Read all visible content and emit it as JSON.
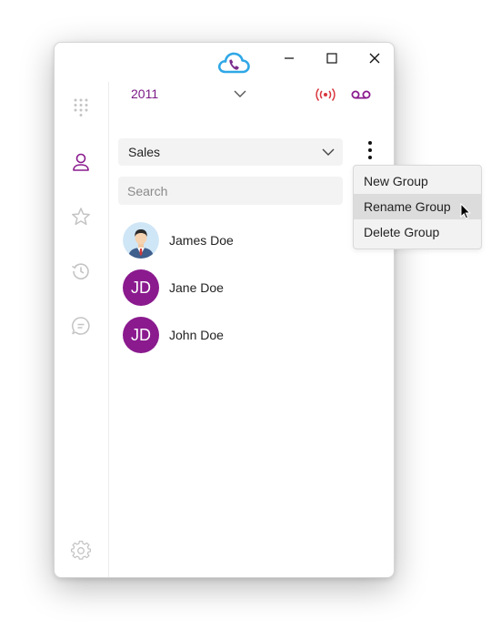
{
  "window": {
    "controls": {
      "minimize": "minimize",
      "maximize": "maximize",
      "close": "close"
    }
  },
  "header": {
    "extension": "2011",
    "status_colors": {
      "broadcast": "#d9363e",
      "voicemail": "#8a1a8e"
    }
  },
  "sidebar": {
    "items": [
      {
        "name": "dialpad-icon"
      },
      {
        "name": "contacts-icon",
        "active": true
      },
      {
        "name": "star-icon"
      },
      {
        "name": "history-icon"
      },
      {
        "name": "chat-icon"
      }
    ],
    "settings": "gear-icon"
  },
  "main": {
    "group_select": {
      "value": "Sales"
    },
    "search": {
      "placeholder": "Search",
      "value": ""
    },
    "contacts": [
      {
        "name": "James Doe",
        "avatar": "photo"
      },
      {
        "name": "Jane Doe",
        "avatar": "JD"
      },
      {
        "name": "John Doe",
        "avatar": "JD"
      }
    ]
  },
  "context_menu": {
    "items": [
      {
        "label": "New Group"
      },
      {
        "label": "Rename Group",
        "hovered": true
      },
      {
        "label": "Delete Group"
      }
    ]
  },
  "colors": {
    "accent": "#8a1a8e",
    "logo": "#2fa7e6"
  }
}
